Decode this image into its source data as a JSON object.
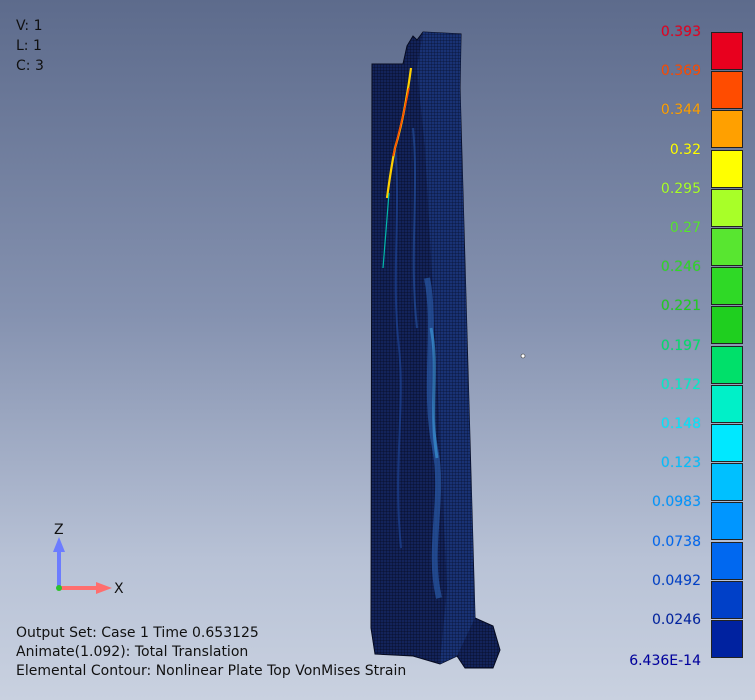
{
  "view_info": {
    "v": "V: 1",
    "l": "L: 1",
    "c": "C: 3"
  },
  "output_info": {
    "line1": "Output Set: Case 1 Time 0.653125",
    "line2": "Animate(1.092): Total Translation",
    "line3": "Elemental Contour: Nonlinear Plate Top VonMises Strain"
  },
  "axes": {
    "z_label": "Z",
    "x_label": "X"
  },
  "legend": {
    "entries": [
      {
        "label": "0.393",
        "color": "#e8001e"
      },
      {
        "label": "0.369",
        "color": "#ff4c00"
      },
      {
        "label": "0.344",
        "color": "#ffa000"
      },
      {
        "label": "0.32",
        "color": "#ffff00"
      },
      {
        "label": "0.295",
        "color": "#a8ff28"
      },
      {
        "label": "0.27",
        "color": "#58e630"
      },
      {
        "label": "0.246",
        "color": "#2fd926"
      },
      {
        "label": "0.221",
        "color": "#1fcf1f"
      },
      {
        "label": "0.197",
        "color": "#00e06a"
      },
      {
        "label": "0.172",
        "color": "#00f0c8"
      },
      {
        "label": "0.148",
        "color": "#00e8ff"
      },
      {
        "label": "0.123",
        "color": "#00c0ff"
      },
      {
        "label": "0.0983",
        "color": "#0096ff"
      },
      {
        "label": "0.0738",
        "color": "#0068f0"
      },
      {
        "label": "0.0492",
        "color": "#0040c8"
      },
      {
        "label": "0.0246",
        "color": "#0022a0"
      },
      {
        "label": "6.436E-14",
        "color": "#0000a0"
      }
    ]
  }
}
